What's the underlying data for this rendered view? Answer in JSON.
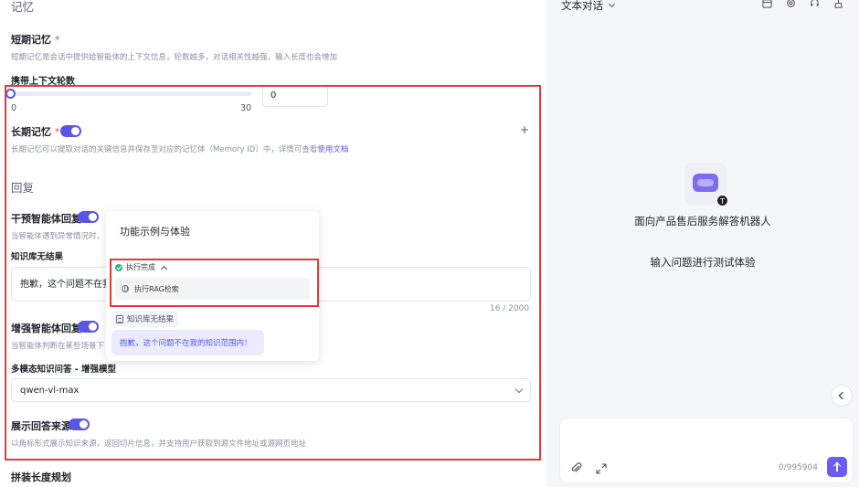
{
  "config": {
    "memory_section_title": "记忆",
    "short_term": {
      "label": "短期记忆",
      "required_mark": "*",
      "hint": "短期记忆是会话中提供给智能体的上下文信息，轮数越多，对话相关性越强，输入长度也会增加"
    },
    "context_rounds": {
      "label": "携带上下文轮数",
      "value": "0",
      "min_label": "0",
      "max_label": "30",
      "fraction": 0
    },
    "long_term": {
      "label": "长期记忆",
      "required_mark": "*",
      "hint_prefix": "长期记忆可以提取对话的关键信息并保存至对应的记忆体（Memory ID）中，详情可查看",
      "hint_link": "使用文档",
      "add_glyph": "+"
    },
    "reply_section_title": "回复",
    "intervene": {
      "label": "干预智能体回复",
      "hint": "当智能体遇到异常情况时，"
    },
    "kb_no_result": {
      "label": "知识库无结果",
      "value": "抱歉，这个问题不在我",
      "counter": "16 / 2000"
    },
    "enhance": {
      "label": "增强智能体回复",
      "hint": "当智能体判断在某些场景下"
    },
    "multimodal": {
      "label": "多模态知识问答 - 增强模型",
      "selected": "qwen-vl-max"
    },
    "show_source": {
      "label": "展示回答来源",
      "hint": "以角标形式展示知识来源，返回切片信息，并支持用户获取到源文件地址或源网页地址"
    },
    "splice_length": {
      "label": "拼装长度规划"
    }
  },
  "popup": {
    "title": "功能示例与体验",
    "status": "执行完成",
    "step": "执行RAG检索",
    "tag": "知识库无结果",
    "reply": "抱歉，这个问题不在我的知识范围内！"
  },
  "chat": {
    "mode_label": "文本对话",
    "bot_name": "面向产品售后服务解答机器人",
    "prompt": "输入问题进行测试体验",
    "avatar_badge": "T",
    "char_count": "0/995904",
    "accent": "#5a55e8"
  }
}
